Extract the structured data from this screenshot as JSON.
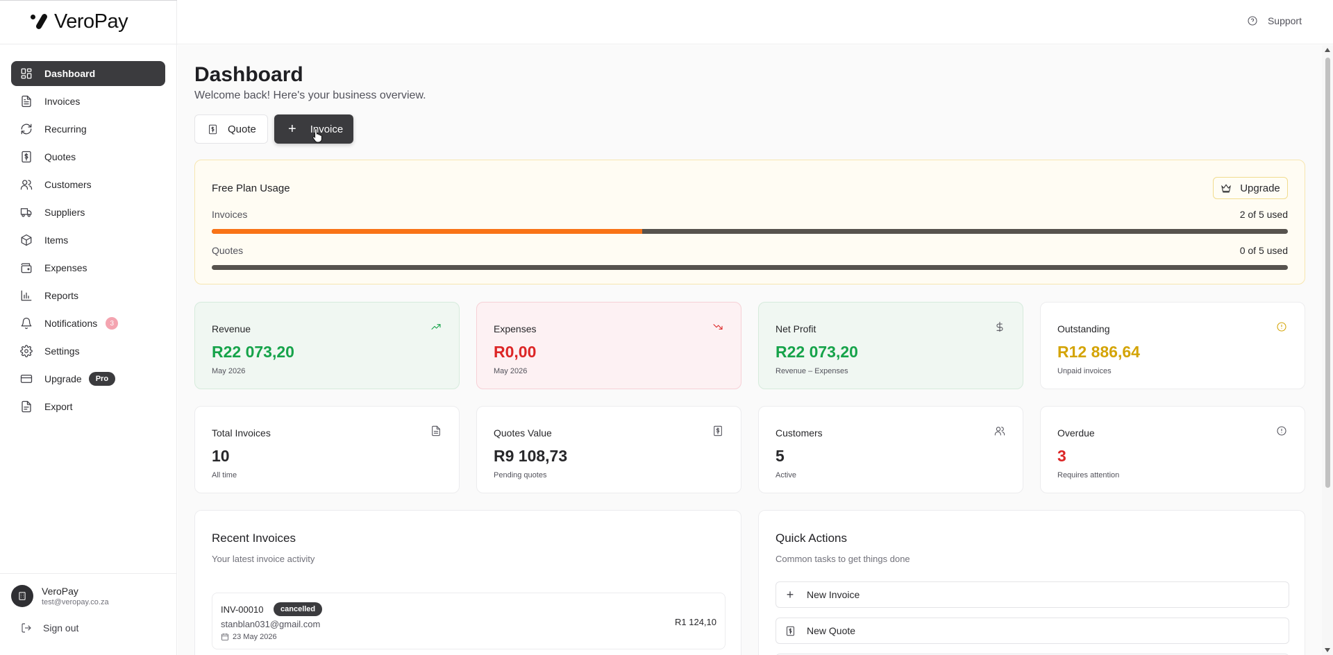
{
  "app": {
    "name": "VeroPay"
  },
  "topbar": {
    "support_label": "Support"
  },
  "sidebar": {
    "items": [
      {
        "label": "Dashboard",
        "icon": "dashboard-icon",
        "active": true
      },
      {
        "label": "Invoices",
        "icon": "file-text-icon"
      },
      {
        "label": "Recurring",
        "icon": "refresh-icon"
      },
      {
        "label": "Quotes",
        "icon": "dollar-file-icon"
      },
      {
        "label": "Customers",
        "icon": "users-icon"
      },
      {
        "label": "Suppliers",
        "icon": "truck-icon"
      },
      {
        "label": "Items",
        "icon": "box-icon"
      },
      {
        "label": "Expenses",
        "icon": "wallet-icon"
      },
      {
        "label": "Reports",
        "icon": "bar-chart-icon"
      },
      {
        "label": "Notifications",
        "icon": "bell-icon",
        "badge": "3"
      },
      {
        "label": "Settings",
        "icon": "gear-icon"
      },
      {
        "label": "Upgrade",
        "icon": "credit-card-icon",
        "tag": "Pro"
      },
      {
        "label": "Export",
        "icon": "export-icon"
      }
    ],
    "user": {
      "name": "VeroPay",
      "email": "test@veropay.co.za"
    },
    "signout_label": "Sign out"
  },
  "page": {
    "title": "Dashboard",
    "subtitle": "Welcome back! Here's your business overview.",
    "quote_button": "Quote",
    "invoice_button": "Invoice"
  },
  "plan": {
    "title": "Free Plan Usage",
    "upgrade_label": "Upgrade",
    "invoices_label": "Invoices",
    "invoices_value": "2 of 5 used",
    "invoices_fraction": 0.4,
    "quotes_label": "Quotes",
    "quotes_value": "0 of 5 used",
    "quotes_fraction": 0.0,
    "accent_color": "#f97316"
  },
  "stats": {
    "revenue": {
      "label": "Revenue",
      "value": "R22 073,20",
      "sub": "May 2026"
    },
    "expenses": {
      "label": "Expenses",
      "value": "R0,00",
      "sub": "May 2026"
    },
    "net_profit": {
      "label": "Net Profit",
      "value": "R22 073,20",
      "sub": "Revenue – Expenses"
    },
    "outstanding": {
      "label": "Outstanding",
      "value": "R12 886,64",
      "sub": "Unpaid invoices"
    },
    "total_invoices": {
      "label": "Total Invoices",
      "value": "10",
      "sub": "All time"
    },
    "quotes_value": {
      "label": "Quotes Value",
      "value": "R9 108,73",
      "sub": "Pending quotes"
    },
    "customers": {
      "label": "Customers",
      "value": "5",
      "sub": "Active"
    },
    "overdue": {
      "label": "Overdue",
      "value": "3",
      "sub": "Requires attention"
    }
  },
  "recent_invoices": {
    "title": "Recent Invoices",
    "subtitle": "Your latest invoice activity",
    "rows": [
      {
        "number": "INV-00010",
        "status": "cancelled",
        "email": "stanblan031@gmail.com",
        "date": "23 May 2026",
        "amount": "R1 124,10"
      }
    ]
  },
  "quick_actions": {
    "title": "Quick Actions",
    "subtitle": "Common tasks to get things done",
    "new_invoice": "New Invoice",
    "new_quote": "New Quote"
  }
}
